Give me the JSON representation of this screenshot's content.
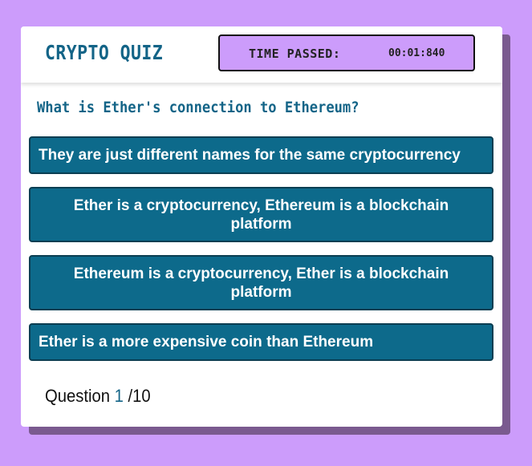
{
  "header": {
    "title": "CRYPTO QUIZ",
    "timer_label": "TIME PASSED:",
    "timer_value": "00:01:840"
  },
  "quiz": {
    "question": "What is Ether's connection to Ethereum?",
    "answers": [
      "They are just different names for the same cryptocurrency",
      "Ether is a cryptocurrency, Ethereum is a blockchain platform",
      "Ethereum is a cryptocurrency, Ether is a blockchain platform",
      "Ether is a more expensive coin than Ethereum"
    ],
    "counter": {
      "prefix": "Question",
      "current": "1",
      "total": "/10"
    }
  },
  "colors": {
    "background": "#cc9cfb",
    "accent": "#136487",
    "answer_bg": "#0d6a8b"
  }
}
